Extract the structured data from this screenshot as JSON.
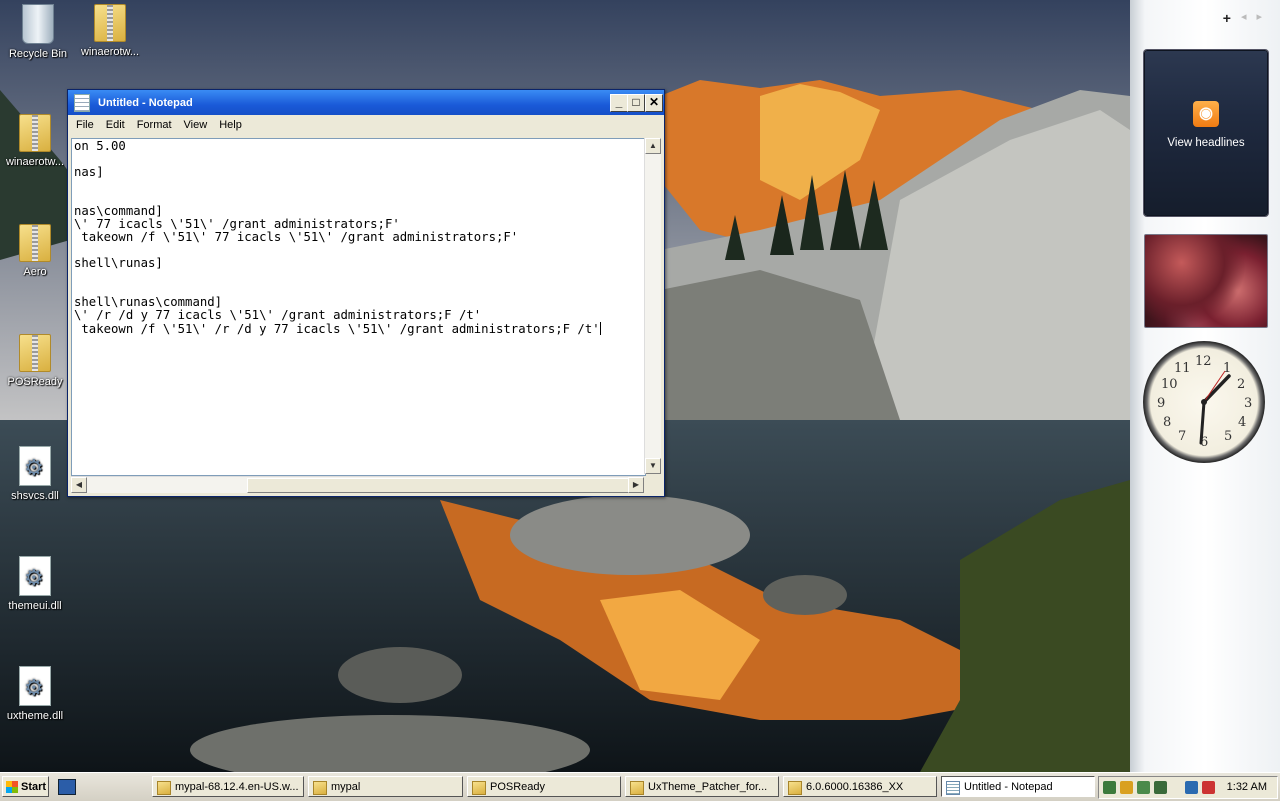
{
  "desktop": {
    "icons": [
      {
        "label": "Recycle Bin"
      },
      {
        "label": "winaerotw..."
      },
      {
        "label": "winaerotw..."
      },
      {
        "label": "Aero"
      },
      {
        "label": "POSReady"
      },
      {
        "label": "shsvcs.dll"
      },
      {
        "label": "themeui.dll"
      },
      {
        "label": "uxtheme.dll"
      }
    ]
  },
  "notepad": {
    "title": "Untitled - Notepad",
    "menu": [
      "File",
      "Edit",
      "Format",
      "View",
      "Help"
    ],
    "buttons": {
      "minimize": "_",
      "maximize": "□",
      "close": "✕"
    },
    "content": "on 5.00\n\nnas]\n\n\nnas\\command]\n\\' 77 icacls \\'51\\' /grant administrators;F'\n takeown /f \\'51\\' 77 icacls \\'51\\' /grant administrators;F'\n\nshell\\runas]\n\n\nshell\\runas\\command]\n\\' /r /d y 77 icacls \\'51\\' /grant administrators;F /t'\n takeown /f \\'51\\' /r /d y 77 icacls \\'51\\' /grant administrators;F /t'"
  },
  "sidebar": {
    "add": "+",
    "prev": "◂",
    "next": "▸",
    "feed_label": "View headlines",
    "clock_numbers": [
      "12",
      "1",
      "2",
      "3",
      "4",
      "5",
      "6",
      "7",
      "8",
      "9",
      "10",
      "11"
    ]
  },
  "taskbar": {
    "start": "Start",
    "tasks": [
      {
        "label": "mypal-68.12.4.en-US.w..."
      },
      {
        "label": "mypal"
      },
      {
        "label": "POSReady"
      },
      {
        "label": "UxTheme_Patcher_for..."
      },
      {
        "label": "6.0.6000.16386_XX"
      },
      {
        "label": "Untitled - Notepad"
      }
    ],
    "clock": "1:32 AM"
  }
}
